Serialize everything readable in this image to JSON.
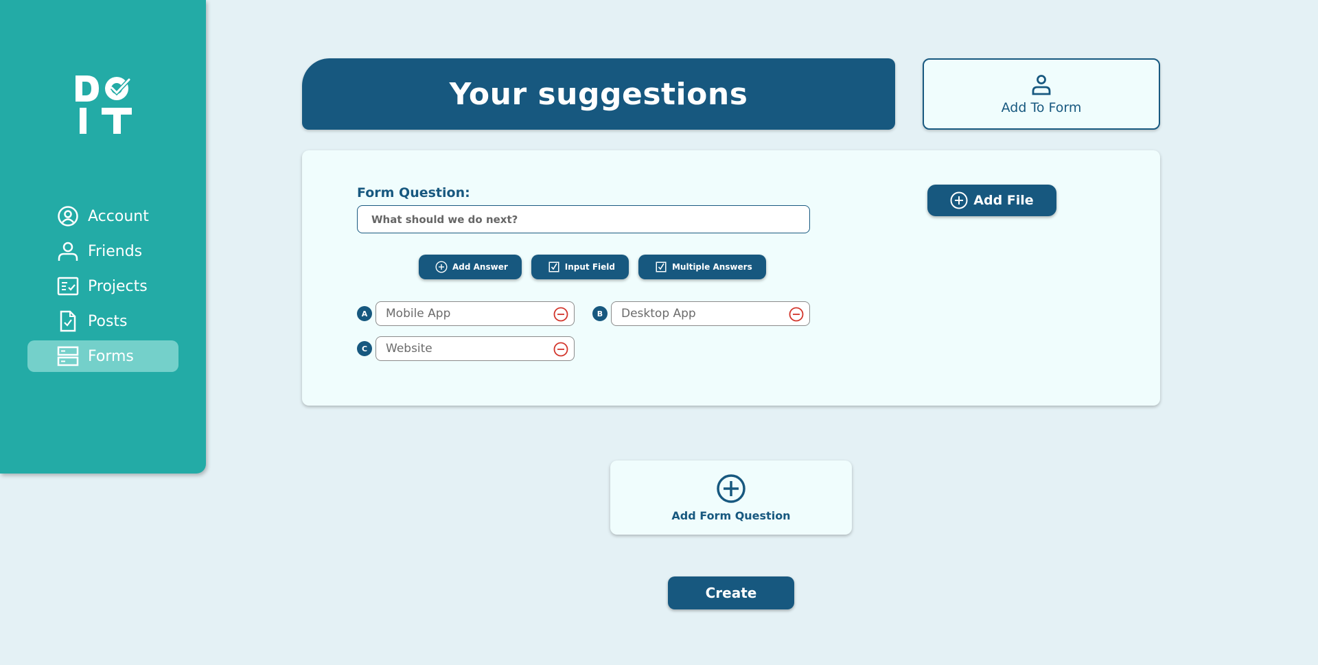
{
  "app": {
    "logo_text": "DO IT"
  },
  "sidebar": {
    "items": [
      {
        "label": "Account",
        "icon": "account-circle-icon",
        "active": false
      },
      {
        "label": "Friends",
        "icon": "person-icon",
        "active": false
      },
      {
        "label": "Projects",
        "icon": "checklist-icon",
        "active": false
      },
      {
        "label": "Posts",
        "icon": "document-check-icon",
        "active": false
      },
      {
        "label": "Forms",
        "icon": "forms-icon",
        "active": true
      }
    ]
  },
  "header": {
    "title": "Your suggestions",
    "add_to_form_label": "Add To Form"
  },
  "form": {
    "question_label": "Form Question:",
    "question_placeholder": "What should we do next?",
    "buttons": {
      "add_answer": "Add Answer",
      "input_field": "Input Field",
      "multiple_answers": "Multiple Answers",
      "add_file": "Add File"
    },
    "answers": [
      {
        "letter": "A",
        "value": "Mobile App"
      },
      {
        "letter": "B",
        "value": "Desktop App"
      },
      {
        "letter": "C",
        "value": "Website"
      }
    ]
  },
  "actions": {
    "add_question_label": "Add Form Question",
    "create_label": "Create"
  },
  "colors": {
    "primary": "#17587f",
    "sidebar": "#23aba6",
    "sidebar_active": "#74d0ca",
    "background": "#e4f1f5",
    "card": "#f0fdfd",
    "remove": "#d2342a"
  }
}
